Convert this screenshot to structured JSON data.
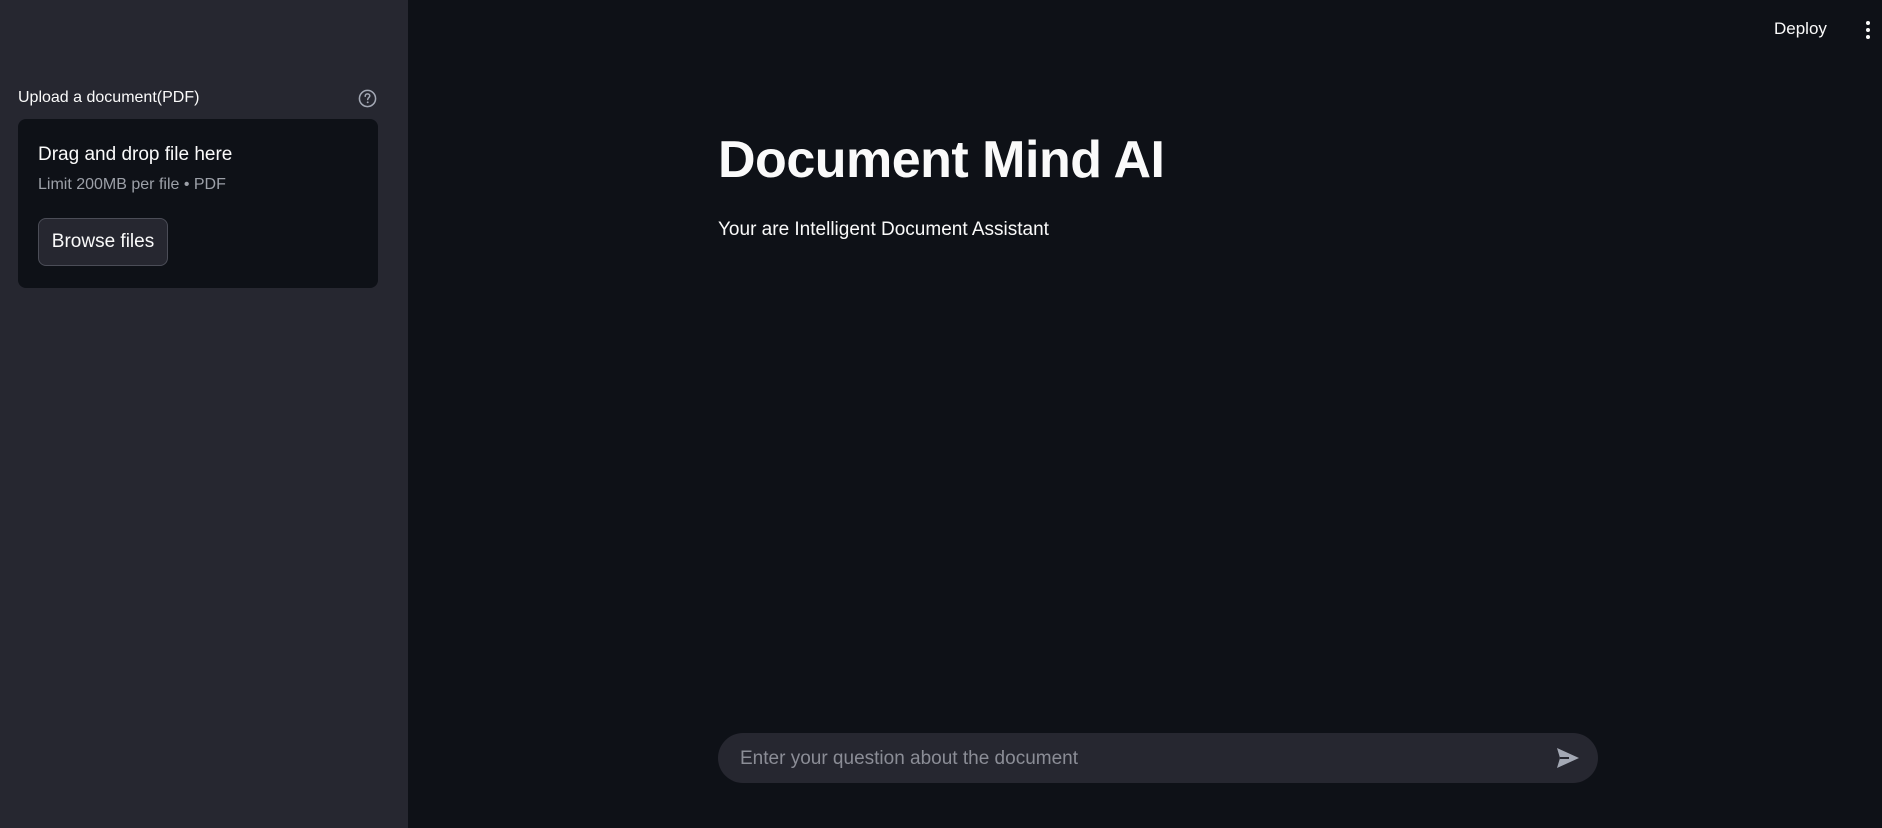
{
  "sidebar": {
    "uploader_label": "Upload a document(PDF)",
    "dropzone_title": "Drag and drop file here",
    "dropzone_limit": "Limit 200MB per file • PDF",
    "browse_label": "Browse files"
  },
  "header": {
    "deploy_label": "Deploy"
  },
  "main": {
    "title": "Document Mind AI",
    "subtitle": "Your are Intelligent Document Assistant"
  },
  "chat": {
    "placeholder": "Enter your question about the document",
    "value": ""
  },
  "icons": {
    "help": "help-circle-icon",
    "menu": "kebab-menu-icon",
    "send": "send-icon"
  },
  "colors": {
    "main_background": "#0e1117",
    "sidebar_background": "#262730",
    "text": "#fafafa",
    "muted_text": "#9ca0a8"
  }
}
